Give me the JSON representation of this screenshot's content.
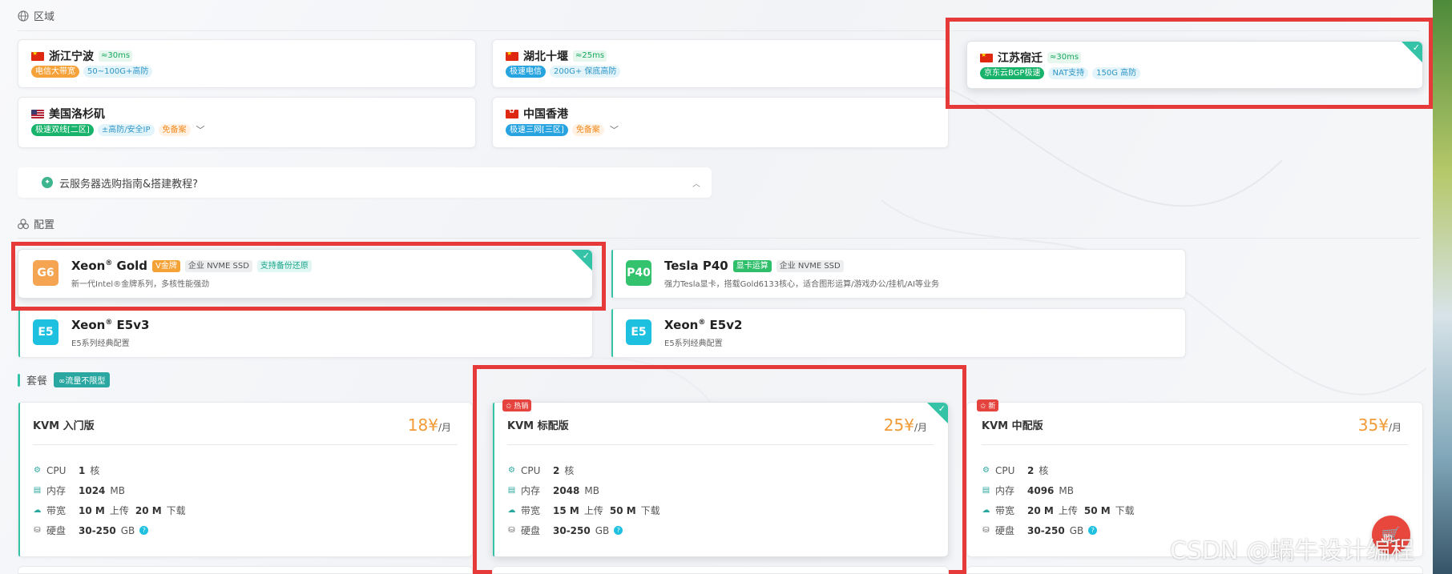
{
  "region": {
    "section_label": "区域",
    "cards": [
      {
        "name": "浙江宁波",
        "flag": "cn",
        "ping": "≈30ms",
        "tags": [
          {
            "text": "电信大带宽",
            "style": "t-orange"
          },
          {
            "text": "50~100G+高防",
            "style": "t-ltblue"
          }
        ],
        "selected": false,
        "chevron": false
      },
      {
        "name": "湖北十堰",
        "flag": "cn",
        "ping": "≈25ms",
        "tags": [
          {
            "text": "极速电信",
            "style": "t-blue"
          },
          {
            "text": "200G+ 保底高防",
            "style": "t-ltblue"
          }
        ],
        "selected": false,
        "chevron": false
      },
      {
        "name": "江苏宿迁",
        "flag": "cn",
        "ping": "≈30ms",
        "tags": [
          {
            "text": "京东云BGP极速",
            "style": "t-green"
          },
          {
            "text": "NAT支持",
            "style": "t-ltblue"
          },
          {
            "text": "150G 高防",
            "style": "t-ltblue"
          }
        ],
        "selected": true,
        "chevron": false
      },
      {
        "name": "美国洛杉矶",
        "flag": "us",
        "ping": "",
        "tags": [
          {
            "text": "极速双线[二区]",
            "style": "t-green"
          },
          {
            "text": "±高防/安全IP",
            "style": "t-ltblue"
          },
          {
            "text": "免备案",
            "style": "t-ltorange"
          }
        ],
        "selected": false,
        "chevron": true
      },
      {
        "name": "中国香港",
        "flag": "hk",
        "ping": "",
        "tags": [
          {
            "text": "极速三网[三区]",
            "style": "t-blue"
          },
          {
            "text": "免备案",
            "style": "t-ltorange"
          }
        ],
        "selected": false,
        "chevron": true
      }
    ],
    "guide_text": "云服务器选购指南&搭建教程?"
  },
  "config": {
    "section_label": "配置",
    "cards": [
      {
        "badge": "G6",
        "badge_color": "b-orange",
        "name": "Xeon",
        "sup": "®",
        "model": " Gold",
        "tags": [
          {
            "text": "V金牌",
            "style": "t-vip"
          },
          {
            "text": "企业 NVME SSD",
            "style": "t-gray"
          },
          {
            "text": "支持备份还原",
            "style": "t-teal"
          }
        ],
        "desc": "新一代Intel®金牌系列，多核性能强劲",
        "selected": true
      },
      {
        "badge": "P40",
        "badge_color": "b-green",
        "name": "Tesla P40",
        "sup": "",
        "model": "",
        "tags": [
          {
            "text": "显卡运算",
            "style": "t-gpu"
          },
          {
            "text": "企业 NVME SSD",
            "style": "t-gray"
          }
        ],
        "desc": "强力Tesla显卡，搭载Gold6133核心，适合图形运算/游戏办公/挂机/AI等业务",
        "selected": false
      },
      {
        "badge": "E5",
        "badge_color": "b-cyan",
        "name": "Xeon",
        "sup": "®",
        "model": " E5v3",
        "tags": [],
        "desc": "E5系列经典配置",
        "selected": false
      },
      {
        "badge": "E5",
        "badge_color": "b-cyan",
        "name": "Xeon",
        "sup": "®",
        "model": " E5v2",
        "tags": [],
        "desc": "E5系列经典配置",
        "selected": false
      }
    ]
  },
  "package": {
    "section_label": "套餐",
    "traffic_tag": "∞流量不限型",
    "plans": [
      {
        "name": "KVM 入门版",
        "price": "18¥",
        "unit": "/月",
        "ribbon": "",
        "cpu": "1",
        "mem": "1024",
        "bw_up": "10 M",
        "bw_down": "20 M",
        "disk": "30-250",
        "selected": false
      },
      {
        "name": "KVM 标配版",
        "price": "25¥",
        "unit": "/月",
        "ribbon": "✩ 热销",
        "cpu": "2",
        "mem": "2048",
        "bw_up": "15 M",
        "bw_down": "50 M",
        "disk": "30-250",
        "selected": true
      },
      {
        "name": "KVM 中配版",
        "price": "35¥",
        "unit": "/月",
        "ribbon": "✩ 新",
        "cpu": "2",
        "mem": "4096",
        "bw_up": "20 M",
        "bw_down": "50 M",
        "disk": "30-250",
        "selected": false
      }
    ],
    "labels": {
      "cpu": "CPU",
      "cpu_unit": "核",
      "mem": "内存",
      "mem_unit": "MB",
      "bw": "带宽",
      "bw_up_suffix": "上传",
      "bw_down_suffix": "下载",
      "disk": "硬盘",
      "disk_unit": "GB",
      "help": "?"
    }
  },
  "cart_label": "购",
  "watermark": "CSDN @蜗牛设计编程",
  "icons": {
    "globe": "globe-icon",
    "config": "cubes-icon",
    "cart": "cart-icon",
    "check": "check-icon"
  },
  "colors": {
    "accent": "#35c3a8",
    "highlight": "#e5393a",
    "price": "#f29a35"
  }
}
